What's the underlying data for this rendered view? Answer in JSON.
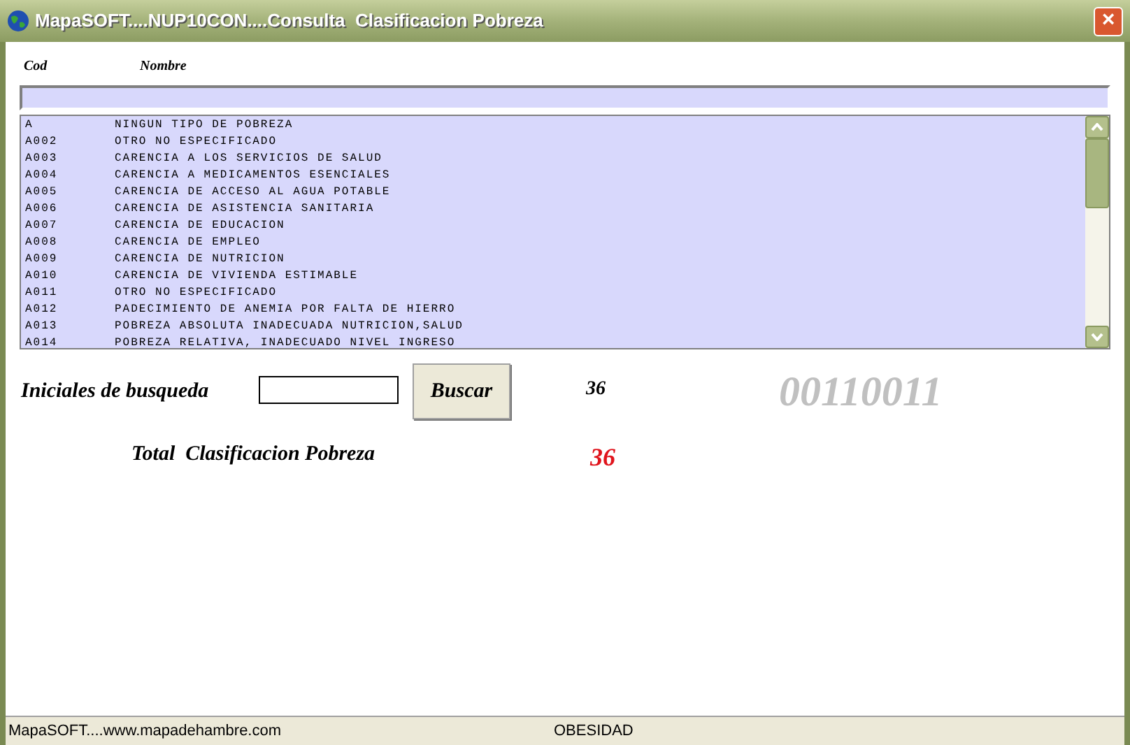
{
  "window": {
    "title": "MapaSOFT....NUP10CON....Consulta  Clasificacion Pobreza",
    "close": "×"
  },
  "columns": [
    "Cod",
    "Nombre"
  ],
  "list": [
    {
      "cod": "A",
      "nombre": "NINGUN TIPO DE POBREZA"
    },
    {
      "cod": "A002",
      "nombre": "OTRO NO ESPECIFICADO"
    },
    {
      "cod": "A003",
      "nombre": "CARENCIA A LOS SERVICIOS DE SALUD"
    },
    {
      "cod": "A004",
      "nombre": "CARENCIA A MEDICAMENTOS ESENCIALES"
    },
    {
      "cod": "A005",
      "nombre": "CARENCIA DE ACCESO AL AGUA POTABLE"
    },
    {
      "cod": "A006",
      "nombre": "CARENCIA DE ASISTENCIA SANITARIA"
    },
    {
      "cod": "A007",
      "nombre": "CARENCIA DE EDUCACION"
    },
    {
      "cod": "A008",
      "nombre": "CARENCIA DE EMPLEO"
    },
    {
      "cod": "A009",
      "nombre": "CARENCIA DE NUTRICION"
    },
    {
      "cod": "A010",
      "nombre": "CARENCIA DE VIVIENDA ESTIMABLE"
    },
    {
      "cod": "A011",
      "nombre": "OTRO NO ESPECIFICADO"
    },
    {
      "cod": "A012",
      "nombre": "PADECIMIENTO DE ANEMIA POR FALTA DE HIERRO"
    },
    {
      "cod": "A013",
      "nombre": "POBREZA ABSOLUTA INADECUADA NUTRICION,SALUD"
    },
    {
      "cod": "A014",
      "nombre": "POBREZA RELATIVA, INADECUADO NIVEL INGRESO"
    }
  ],
  "search": {
    "label": "Iniciales de busqueda",
    "button": "Buscar",
    "count": "36",
    "code": "00110011"
  },
  "total": {
    "label": "Total  Clasificacion Pobreza",
    "value": "36"
  },
  "status_bar": [
    "MapaSOFT....www.mapadehambre.com",
    "OBESIDAD"
  ]
}
